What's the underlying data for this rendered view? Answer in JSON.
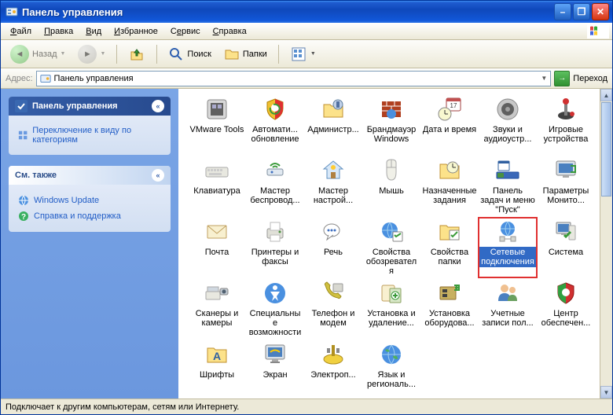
{
  "title": "Панель управления",
  "menus": [
    "Файл",
    "Правка",
    "Вид",
    "Избранное",
    "Сервис",
    "Справка"
  ],
  "toolbar": {
    "back": "Назад",
    "search": "Поиск",
    "folders": "Папки"
  },
  "address": {
    "label": "Адрес:",
    "value": "Панель управления",
    "go": "Переход"
  },
  "side": {
    "panel_title": "Панель управления",
    "switch_view": "Переключение к виду по категориям",
    "see_also": "См. также",
    "windows_update": "Windows Update",
    "help": "Справка и поддержка"
  },
  "icons": [
    {
      "label": "VMware Tools",
      "svg": "vm"
    },
    {
      "label": "Автомати... обновление",
      "svg": "shield"
    },
    {
      "label": "Администр...",
      "svg": "admin"
    },
    {
      "label": "Брандмауэр Windows",
      "svg": "firewall"
    },
    {
      "label": "Дата и время",
      "svg": "clock"
    },
    {
      "label": "Звуки и аудиоустр...",
      "svg": "speaker"
    },
    {
      "label": "Игровые устройства",
      "svg": "joystick"
    },
    {
      "label": "Клавиатура",
      "svg": "keyboard"
    },
    {
      "label": "Мастер беспровод...",
      "svg": "wireless"
    },
    {
      "label": "Мастер настрой...",
      "svg": "nethome"
    },
    {
      "label": "Мышь",
      "svg": "mouse"
    },
    {
      "label": "Назначенные задания",
      "svg": "sched"
    },
    {
      "label": "Панель задач и меню \"Пуск\"",
      "svg": "taskbar"
    },
    {
      "label": "Параметры Монито...",
      "svg": "monitorcfg"
    },
    {
      "label": "Почта",
      "svg": "mail"
    },
    {
      "label": "Принтеры и факсы",
      "svg": "printer"
    },
    {
      "label": "Речь",
      "svg": "speech"
    },
    {
      "label": "Свойства обозревателя",
      "svg": "inetopt"
    },
    {
      "label": "Свойства папки",
      "svg": "folderopt"
    },
    {
      "label": "Сетевые подключения",
      "svg": "netconn",
      "selected": true,
      "highlight": true
    },
    {
      "label": "Система",
      "svg": "system"
    },
    {
      "label": "Сканеры и камеры",
      "svg": "scanner"
    },
    {
      "label": "Специальные возможности",
      "svg": "access"
    },
    {
      "label": "Телефон и модем",
      "svg": "phone"
    },
    {
      "label": "Установка и удаление...",
      "svg": "addremove"
    },
    {
      "label": "Установка оборудова...",
      "svg": "addhw"
    },
    {
      "label": "Учетные записи пол...",
      "svg": "users"
    },
    {
      "label": "Центр обеспечен...",
      "svg": "security"
    },
    {
      "label": "Шрифты",
      "svg": "fonts"
    },
    {
      "label": "Экран",
      "svg": "display"
    },
    {
      "label": "Электроп...",
      "svg": "power"
    },
    {
      "label": "Язык и региональ...",
      "svg": "regional"
    }
  ],
  "status": "Подключает к другим компьютерам, сетям или Интернету."
}
